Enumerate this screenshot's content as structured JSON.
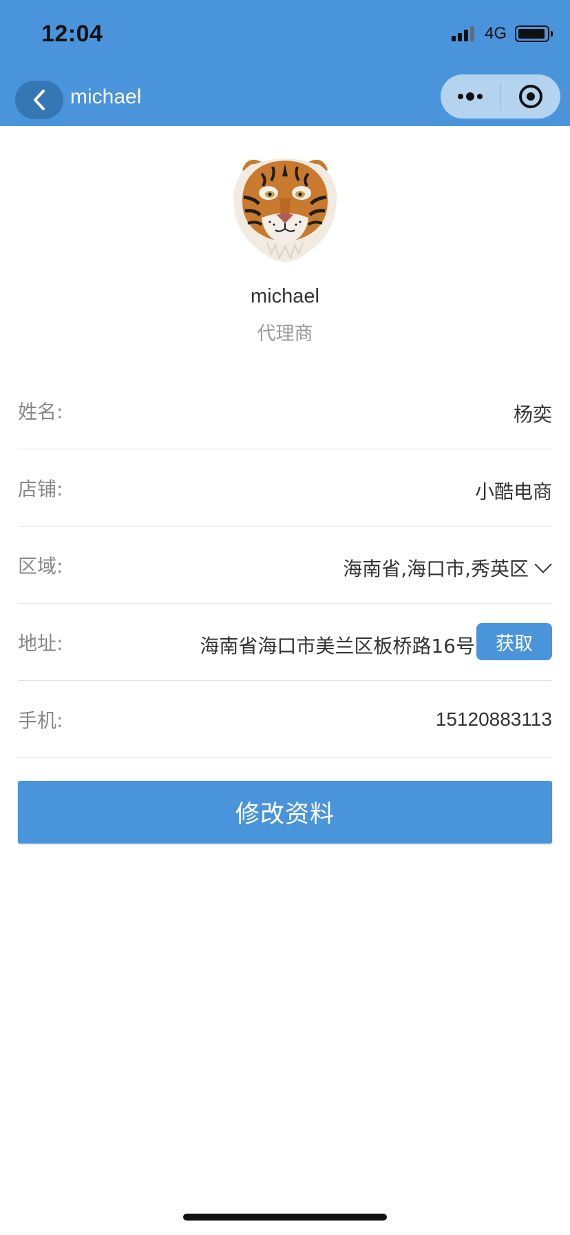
{
  "status_bar": {
    "time": "12:04",
    "network": "4G",
    "signal_icon": "signal-bars-icon",
    "battery_icon": "battery-icon"
  },
  "nav": {
    "title": "michael",
    "back_icon": "back-arrow-icon",
    "more_icon": "more-dots-icon",
    "close_icon": "target-icon"
  },
  "profile": {
    "avatar_icon": "tiger-avatar",
    "name": "michael",
    "role": "代理商"
  },
  "fields": {
    "name": {
      "label": "姓名:",
      "value": "杨奕"
    },
    "shop": {
      "label": "店铺:",
      "value": "小酷电商"
    },
    "region": {
      "label": "区域:",
      "value": "海南省,海口市,秀英区"
    },
    "address": {
      "label": "地址:",
      "value": "海南省海口市美兰区板桥路16号",
      "button": "获取"
    },
    "phone": {
      "label": "手机:",
      "value": "15120883113"
    }
  },
  "actions": {
    "submit_label": "修改资料"
  },
  "colors": {
    "primary": "#4a94db",
    "back_button": "#3577b4",
    "capsule": "#b4d3ef",
    "label": "#888888",
    "text": "#333333",
    "muted": "#999999",
    "divider": "#e2e2e2"
  }
}
